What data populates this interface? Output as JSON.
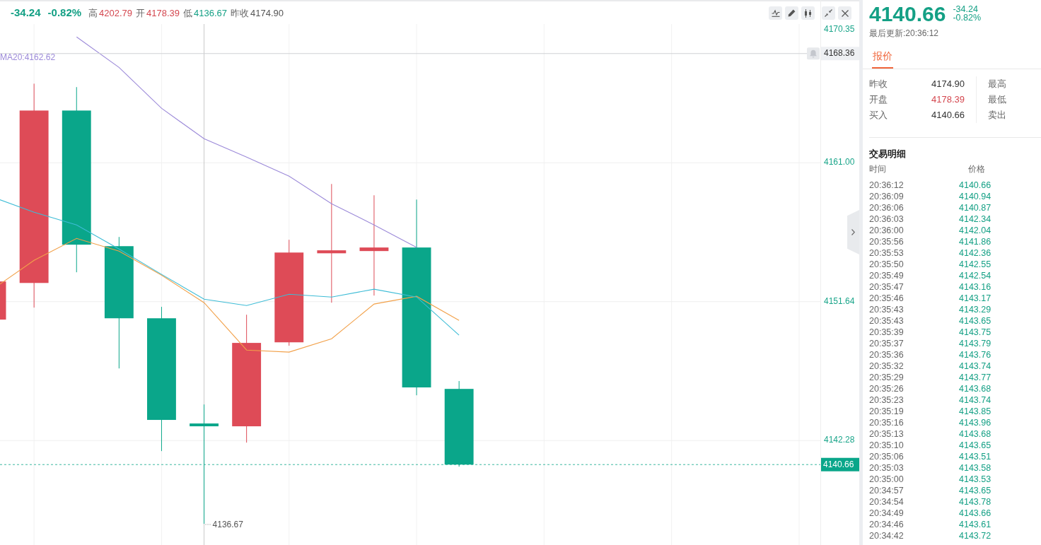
{
  "header": {
    "change": "-34.24",
    "change_pct": "-0.82%",
    "stats": [
      {
        "label": "高",
        "value": "4202.79",
        "color": "#d4474f"
      },
      {
        "label": "开",
        "value": "4178.39",
        "color": "#d4474f"
      },
      {
        "label": "低",
        "value": "4136.67",
        "color": "#14a085"
      },
      {
        "label": "昨收",
        "value": "4174.90",
        "color": "#555555"
      }
    ]
  },
  "chart": {
    "ma_readout": "MA20:4162.62",
    "chart_data": {
      "type": "candlestick",
      "categories": [
        null,
        null,
        null,
        null,
        null,
        null,
        null,
        null,
        null,
        null,
        null,
        null,
        null,
        null,
        null,
        null,
        null,
        null,
        null,
        null
      ],
      "ohlc": [
        [
          4150.43,
          4153.0,
          4150.43,
          4153.0
        ],
        [
          4152.9,
          4166.33,
          4151.24,
          4164.52
        ],
        [
          4164.52,
          4166.1,
          4153.62,
          4155.48
        ],
        [
          4155.38,
          4156.0,
          4147.14,
          4150.52
        ],
        [
          4150.52,
          4151.29,
          4141.57,
          4143.67
        ],
        [
          4143.43,
          4144.71,
          4136.67,
          4143.24
        ],
        [
          4143.24,
          4150.76,
          4142.14,
          4148.86
        ],
        [
          4148.9,
          4155.81,
          4148.67,
          4154.95
        ],
        [
          4154.9,
          4159.57,
          4151.57,
          4155.1
        ],
        [
          4155.05,
          4158.81,
          4152.05,
          4155.29
        ],
        [
          4155.29,
          4158.52,
          4145.33,
          4145.86
        ],
        [
          4145.76,
          4146.29,
          4140.52,
          4140.66
        ],
        null,
        null,
        null,
        null,
        null,
        null,
        null,
        null
      ],
      "series": [
        {
          "type": "line",
          "color": "#f2a14a",
          "values": [
            4152.43,
            4154.43,
            4155.9,
            4155.05,
            4153.43,
            4151.57,
            4148.38,
            4148.24,
            4149.14,
            4151.48,
            4152.0,
            4150.38,
            null,
            null,
            null,
            null,
            null,
            null,
            null,
            null
          ]
        },
        {
          "type": "line",
          "color": "#3dbcd6",
          "values": [
            4158.71,
            4157.67,
            4156.81,
            4155.19,
            4153.48,
            4151.81,
            4151.38,
            4152.14,
            4151.95,
            4152.48,
            4151.95,
            4149.38,
            null,
            null,
            null,
            null,
            null,
            null,
            null,
            null
          ]
        },
        {
          "type": "line",
          "color": "#9c8ad9",
          "values": [
            null,
            null,
            4169.48,
            4167.43,
            4164.67,
            4162.62,
            4161.38,
            4160.1,
            4158.24,
            4156.81,
            4155.29,
            null,
            null,
            null,
            null,
            null,
            null,
            null,
            null,
            null
          ]
        }
      ],
      "ylim": [
        4135.24,
        4170.35
      ],
      "yticks": [
        {
          "value": 4170.35,
          "label": "4170.35"
        },
        {
          "value": 4161.0,
          "label": "4161.00"
        },
        {
          "value": 4151.64,
          "label": "4151.64"
        },
        {
          "value": 4142.28,
          "label": "4142.28"
        }
      ],
      "ref_lines": [
        {
          "axis": "y",
          "value": 4168.36,
          "label": "4168.36",
          "color": "#cfd1d4",
          "line_style": "solid"
        },
        {
          "axis": "y",
          "value": 4140.66,
          "label": "4140.66",
          "color": "#0aa68a",
          "line_style": "dashed"
        }
      ],
      "annotations": [
        "4136.67"
      ],
      "grid": true
    }
  },
  "quote_panel": {
    "price": "4140.66",
    "change": "-34.24",
    "change_pct": "-0.82%",
    "updated": "最后更新:20:36:12",
    "tabs": [
      {
        "label": "报价",
        "selected": true
      }
    ],
    "quotes_left": [
      {
        "label": "昨收",
        "value": "4174.90",
        "color": "#333333"
      },
      {
        "label": "开盘",
        "value": "4178.39",
        "color": "#d4474f"
      },
      {
        "label": "买入",
        "value": "4140.66",
        "color": "#333333"
      }
    ],
    "quotes_right": [
      "最高",
      "最低",
      "卖出"
    ]
  },
  "trades": {
    "title": "交易明细",
    "columns": [
      "时间",
      "价格"
    ],
    "rows": [
      {
        "time": "20:36:12",
        "price": "4140.66"
      },
      {
        "time": "20:36:09",
        "price": "4140.94"
      },
      {
        "time": "20:36:06",
        "price": "4140.87"
      },
      {
        "time": "20:36:03",
        "price": "4142.34"
      },
      {
        "time": "20:36:00",
        "price": "4142.04"
      },
      {
        "time": "20:35:56",
        "price": "4141.86"
      },
      {
        "time": "20:35:53",
        "price": "4142.36"
      },
      {
        "time": "20:35:50",
        "price": "4142.55"
      },
      {
        "time": "20:35:49",
        "price": "4142.54"
      },
      {
        "time": "20:35:47",
        "price": "4143.16"
      },
      {
        "time": "20:35:46",
        "price": "4143.17"
      },
      {
        "time": "20:35:43",
        "price": "4143.29"
      },
      {
        "time": "20:35:43",
        "price": "4143.65"
      },
      {
        "time": "20:35:39",
        "price": "4143.75"
      },
      {
        "time": "20:35:37",
        "price": "4143.79"
      },
      {
        "time": "20:35:36",
        "price": "4143.76"
      },
      {
        "time": "20:35:32",
        "price": "4143.74"
      },
      {
        "time": "20:35:29",
        "price": "4143.77"
      },
      {
        "time": "20:35:26",
        "price": "4143.68"
      },
      {
        "time": "20:35:23",
        "price": "4143.74"
      },
      {
        "time": "20:35:19",
        "price": "4143.85"
      },
      {
        "time": "20:35:16",
        "price": "4143.96"
      },
      {
        "time": "20:35:13",
        "price": "4143.68"
      },
      {
        "time": "20:35:10",
        "price": "4143.65"
      },
      {
        "time": "20:35:06",
        "price": "4143.51"
      },
      {
        "time": "20:35:03",
        "price": "4143.58"
      },
      {
        "time": "20:35:00",
        "price": "4143.53"
      },
      {
        "time": "20:34:57",
        "price": "4143.65"
      },
      {
        "time": "20:34:54",
        "price": "4143.78"
      },
      {
        "time": "20:34:49",
        "price": "4143.66"
      },
      {
        "time": "20:34:46",
        "price": "4143.61"
      },
      {
        "time": "20:34:42",
        "price": "4143.72"
      }
    ]
  }
}
